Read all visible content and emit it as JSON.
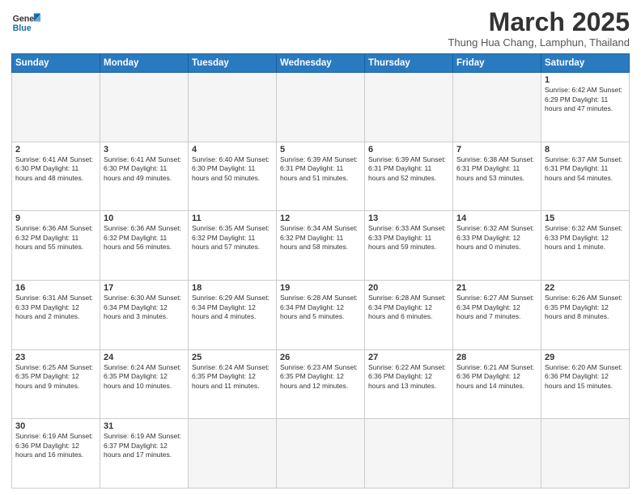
{
  "header": {
    "logo_general": "General",
    "logo_blue": "Blue",
    "month_title": "March 2025",
    "location": "Thung Hua Chang, Lamphun, Thailand"
  },
  "weekdays": [
    "Sunday",
    "Monday",
    "Tuesday",
    "Wednesday",
    "Thursday",
    "Friday",
    "Saturday"
  ],
  "weeks": [
    [
      {
        "day": "",
        "empty": true,
        "info": ""
      },
      {
        "day": "",
        "empty": true,
        "info": ""
      },
      {
        "day": "",
        "empty": true,
        "info": ""
      },
      {
        "day": "",
        "empty": true,
        "info": ""
      },
      {
        "day": "",
        "empty": true,
        "info": ""
      },
      {
        "day": "",
        "empty": true,
        "info": ""
      },
      {
        "day": "1",
        "empty": false,
        "info": "Sunrise: 6:42 AM\nSunset: 6:29 PM\nDaylight: 11 hours\nand 47 minutes."
      }
    ],
    [
      {
        "day": "2",
        "empty": false,
        "info": "Sunrise: 6:41 AM\nSunset: 6:30 PM\nDaylight: 11 hours\nand 48 minutes."
      },
      {
        "day": "3",
        "empty": false,
        "info": "Sunrise: 6:41 AM\nSunset: 6:30 PM\nDaylight: 11 hours\nand 49 minutes."
      },
      {
        "day": "4",
        "empty": false,
        "info": "Sunrise: 6:40 AM\nSunset: 6:30 PM\nDaylight: 11 hours\nand 50 minutes."
      },
      {
        "day": "5",
        "empty": false,
        "info": "Sunrise: 6:39 AM\nSunset: 6:31 PM\nDaylight: 11 hours\nand 51 minutes."
      },
      {
        "day": "6",
        "empty": false,
        "info": "Sunrise: 6:39 AM\nSunset: 6:31 PM\nDaylight: 11 hours\nand 52 minutes."
      },
      {
        "day": "7",
        "empty": false,
        "info": "Sunrise: 6:38 AM\nSunset: 6:31 PM\nDaylight: 11 hours\nand 53 minutes."
      },
      {
        "day": "8",
        "empty": false,
        "info": "Sunrise: 6:37 AM\nSunset: 6:31 PM\nDaylight: 11 hours\nand 54 minutes."
      }
    ],
    [
      {
        "day": "9",
        "empty": false,
        "info": "Sunrise: 6:36 AM\nSunset: 6:32 PM\nDaylight: 11 hours\nand 55 minutes."
      },
      {
        "day": "10",
        "empty": false,
        "info": "Sunrise: 6:36 AM\nSunset: 6:32 PM\nDaylight: 11 hours\nand 56 minutes."
      },
      {
        "day": "11",
        "empty": false,
        "info": "Sunrise: 6:35 AM\nSunset: 6:32 PM\nDaylight: 11 hours\nand 57 minutes."
      },
      {
        "day": "12",
        "empty": false,
        "info": "Sunrise: 6:34 AM\nSunset: 6:32 PM\nDaylight: 11 hours\nand 58 minutes."
      },
      {
        "day": "13",
        "empty": false,
        "info": "Sunrise: 6:33 AM\nSunset: 6:33 PM\nDaylight: 11 hours\nand 59 minutes."
      },
      {
        "day": "14",
        "empty": false,
        "info": "Sunrise: 6:32 AM\nSunset: 6:33 PM\nDaylight: 12 hours\nand 0 minutes."
      },
      {
        "day": "15",
        "empty": false,
        "info": "Sunrise: 6:32 AM\nSunset: 6:33 PM\nDaylight: 12 hours\nand 1 minute."
      }
    ],
    [
      {
        "day": "16",
        "empty": false,
        "info": "Sunrise: 6:31 AM\nSunset: 6:33 PM\nDaylight: 12 hours\nand 2 minutes."
      },
      {
        "day": "17",
        "empty": false,
        "info": "Sunrise: 6:30 AM\nSunset: 6:34 PM\nDaylight: 12 hours\nand 3 minutes."
      },
      {
        "day": "18",
        "empty": false,
        "info": "Sunrise: 6:29 AM\nSunset: 6:34 PM\nDaylight: 12 hours\nand 4 minutes."
      },
      {
        "day": "19",
        "empty": false,
        "info": "Sunrise: 6:28 AM\nSunset: 6:34 PM\nDaylight: 12 hours\nand 5 minutes."
      },
      {
        "day": "20",
        "empty": false,
        "info": "Sunrise: 6:28 AM\nSunset: 6:34 PM\nDaylight: 12 hours\nand 6 minutes."
      },
      {
        "day": "21",
        "empty": false,
        "info": "Sunrise: 6:27 AM\nSunset: 6:34 PM\nDaylight: 12 hours\nand 7 minutes."
      },
      {
        "day": "22",
        "empty": false,
        "info": "Sunrise: 6:26 AM\nSunset: 6:35 PM\nDaylight: 12 hours\nand 8 minutes."
      }
    ],
    [
      {
        "day": "23",
        "empty": false,
        "info": "Sunrise: 6:25 AM\nSunset: 6:35 PM\nDaylight: 12 hours\nand 9 minutes."
      },
      {
        "day": "24",
        "empty": false,
        "info": "Sunrise: 6:24 AM\nSunset: 6:35 PM\nDaylight: 12 hours\nand 10 minutes."
      },
      {
        "day": "25",
        "empty": false,
        "info": "Sunrise: 6:24 AM\nSunset: 6:35 PM\nDaylight: 12 hours\nand 11 minutes."
      },
      {
        "day": "26",
        "empty": false,
        "info": "Sunrise: 6:23 AM\nSunset: 6:35 PM\nDaylight: 12 hours\nand 12 minutes."
      },
      {
        "day": "27",
        "empty": false,
        "info": "Sunrise: 6:22 AM\nSunset: 6:36 PM\nDaylight: 12 hours\nand 13 minutes."
      },
      {
        "day": "28",
        "empty": false,
        "info": "Sunrise: 6:21 AM\nSunset: 6:36 PM\nDaylight: 12 hours\nand 14 minutes."
      },
      {
        "day": "29",
        "empty": false,
        "info": "Sunrise: 6:20 AM\nSunset: 6:36 PM\nDaylight: 12 hours\nand 15 minutes."
      }
    ],
    [
      {
        "day": "30",
        "empty": false,
        "info": "Sunrise: 6:19 AM\nSunset: 6:36 PM\nDaylight: 12 hours\nand 16 minutes."
      },
      {
        "day": "31",
        "empty": false,
        "info": "Sunrise: 6:19 AM\nSunset: 6:37 PM\nDaylight: 12 hours\nand 17 minutes."
      },
      {
        "day": "",
        "empty": true,
        "info": ""
      },
      {
        "day": "",
        "empty": true,
        "info": ""
      },
      {
        "day": "",
        "empty": true,
        "info": ""
      },
      {
        "day": "",
        "empty": true,
        "info": ""
      },
      {
        "day": "",
        "empty": true,
        "info": ""
      }
    ]
  ]
}
